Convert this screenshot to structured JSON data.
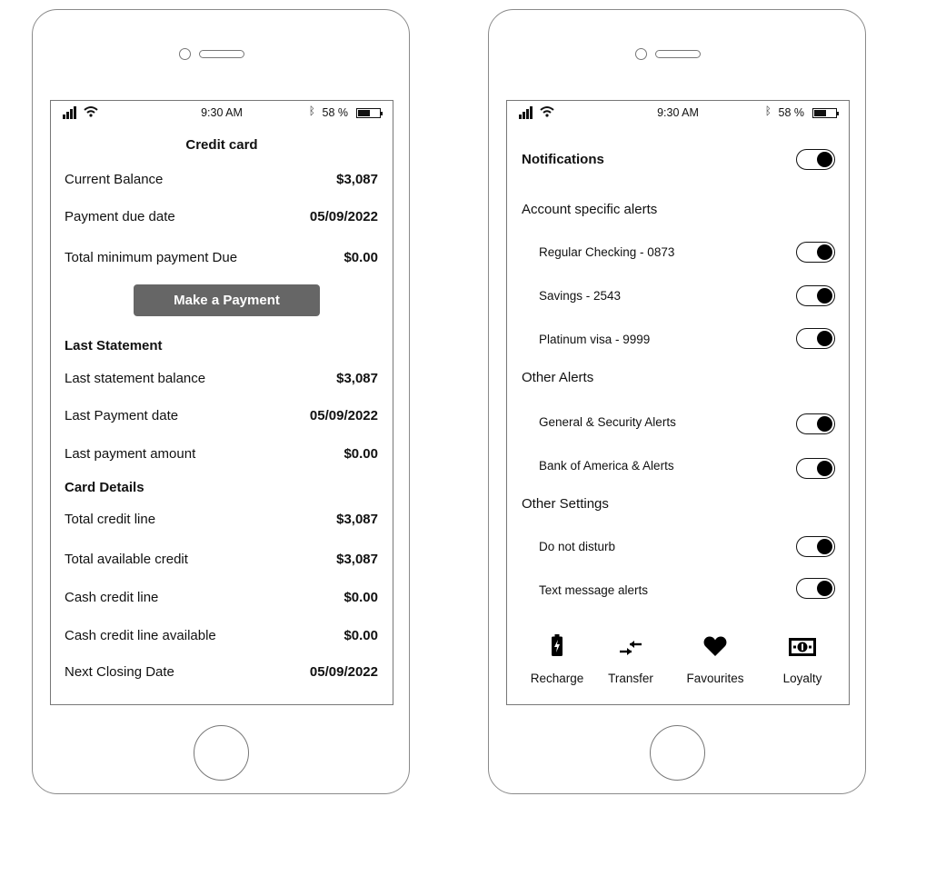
{
  "status": {
    "time": "9:30 AM",
    "battery": "58 %",
    "bluetooth_icon": "bluetooth-icon",
    "signal_icon": "signal-icon",
    "wifi_icon": "wifi-icon",
    "battery_level": 0.5
  },
  "credit_card": {
    "title": "Credit card",
    "summary": [
      {
        "label": "Current Balance",
        "value": "$3,087"
      },
      {
        "label": "Payment due date",
        "value": "05/09/2022"
      },
      {
        "label": "Total minimum payment Due",
        "value": "$0.00"
      }
    ],
    "pay_button": "Make a Payment",
    "last_statement_title": "Last Statement",
    "last_statement": [
      {
        "label": "Last statement balance",
        "value": "$3,087"
      },
      {
        "label": "Last Payment date",
        "value": "05/09/2022"
      },
      {
        "label": "Last payment amount",
        "value": "$0.00"
      }
    ],
    "card_details_title": "Card Details",
    "card_details": [
      {
        "label": "Total credit line",
        "value": "$3,087"
      },
      {
        "label": "Total available credit",
        "value": "$3,087"
      },
      {
        "label": "Cash credit line",
        "value": "$0.00"
      },
      {
        "label": "Cash credit line available",
        "value": "$0.00"
      },
      {
        "label": "Next Closing Date",
        "value": "05/09/2022"
      }
    ]
  },
  "settings": {
    "notifications": {
      "label": "Notifications",
      "on": true
    },
    "account_alerts_title": "Account specific alerts",
    "account_alerts": [
      {
        "label": "Regular Checking - 0873",
        "on": true
      },
      {
        "label": "Savings - 2543",
        "on": true
      },
      {
        "label": "Platinum visa - 9999",
        "on": true
      }
    ],
    "other_alerts_title": "Other Alerts",
    "other_alerts": [
      {
        "label": "General & Security Alerts",
        "on": true
      },
      {
        "label": "Bank of America & Alerts",
        "on": true
      }
    ],
    "other_settings_title": "Other Settings",
    "other_settings": [
      {
        "label": "Do not disturb",
        "on": true
      },
      {
        "label": "Text message alerts",
        "on": true
      }
    ]
  },
  "bottom_nav": [
    {
      "label": "Recharge",
      "icon": "battery-charge-icon"
    },
    {
      "label": "Transfer",
      "icon": "transfer-arrows-icon"
    },
    {
      "label": "Favourites",
      "icon": "heart-icon"
    },
    {
      "label": "Loyalty",
      "icon": "banknote-icon"
    }
  ],
  "colors": {
    "button_bg": "#666666",
    "toggle_knob": "#000000"
  }
}
